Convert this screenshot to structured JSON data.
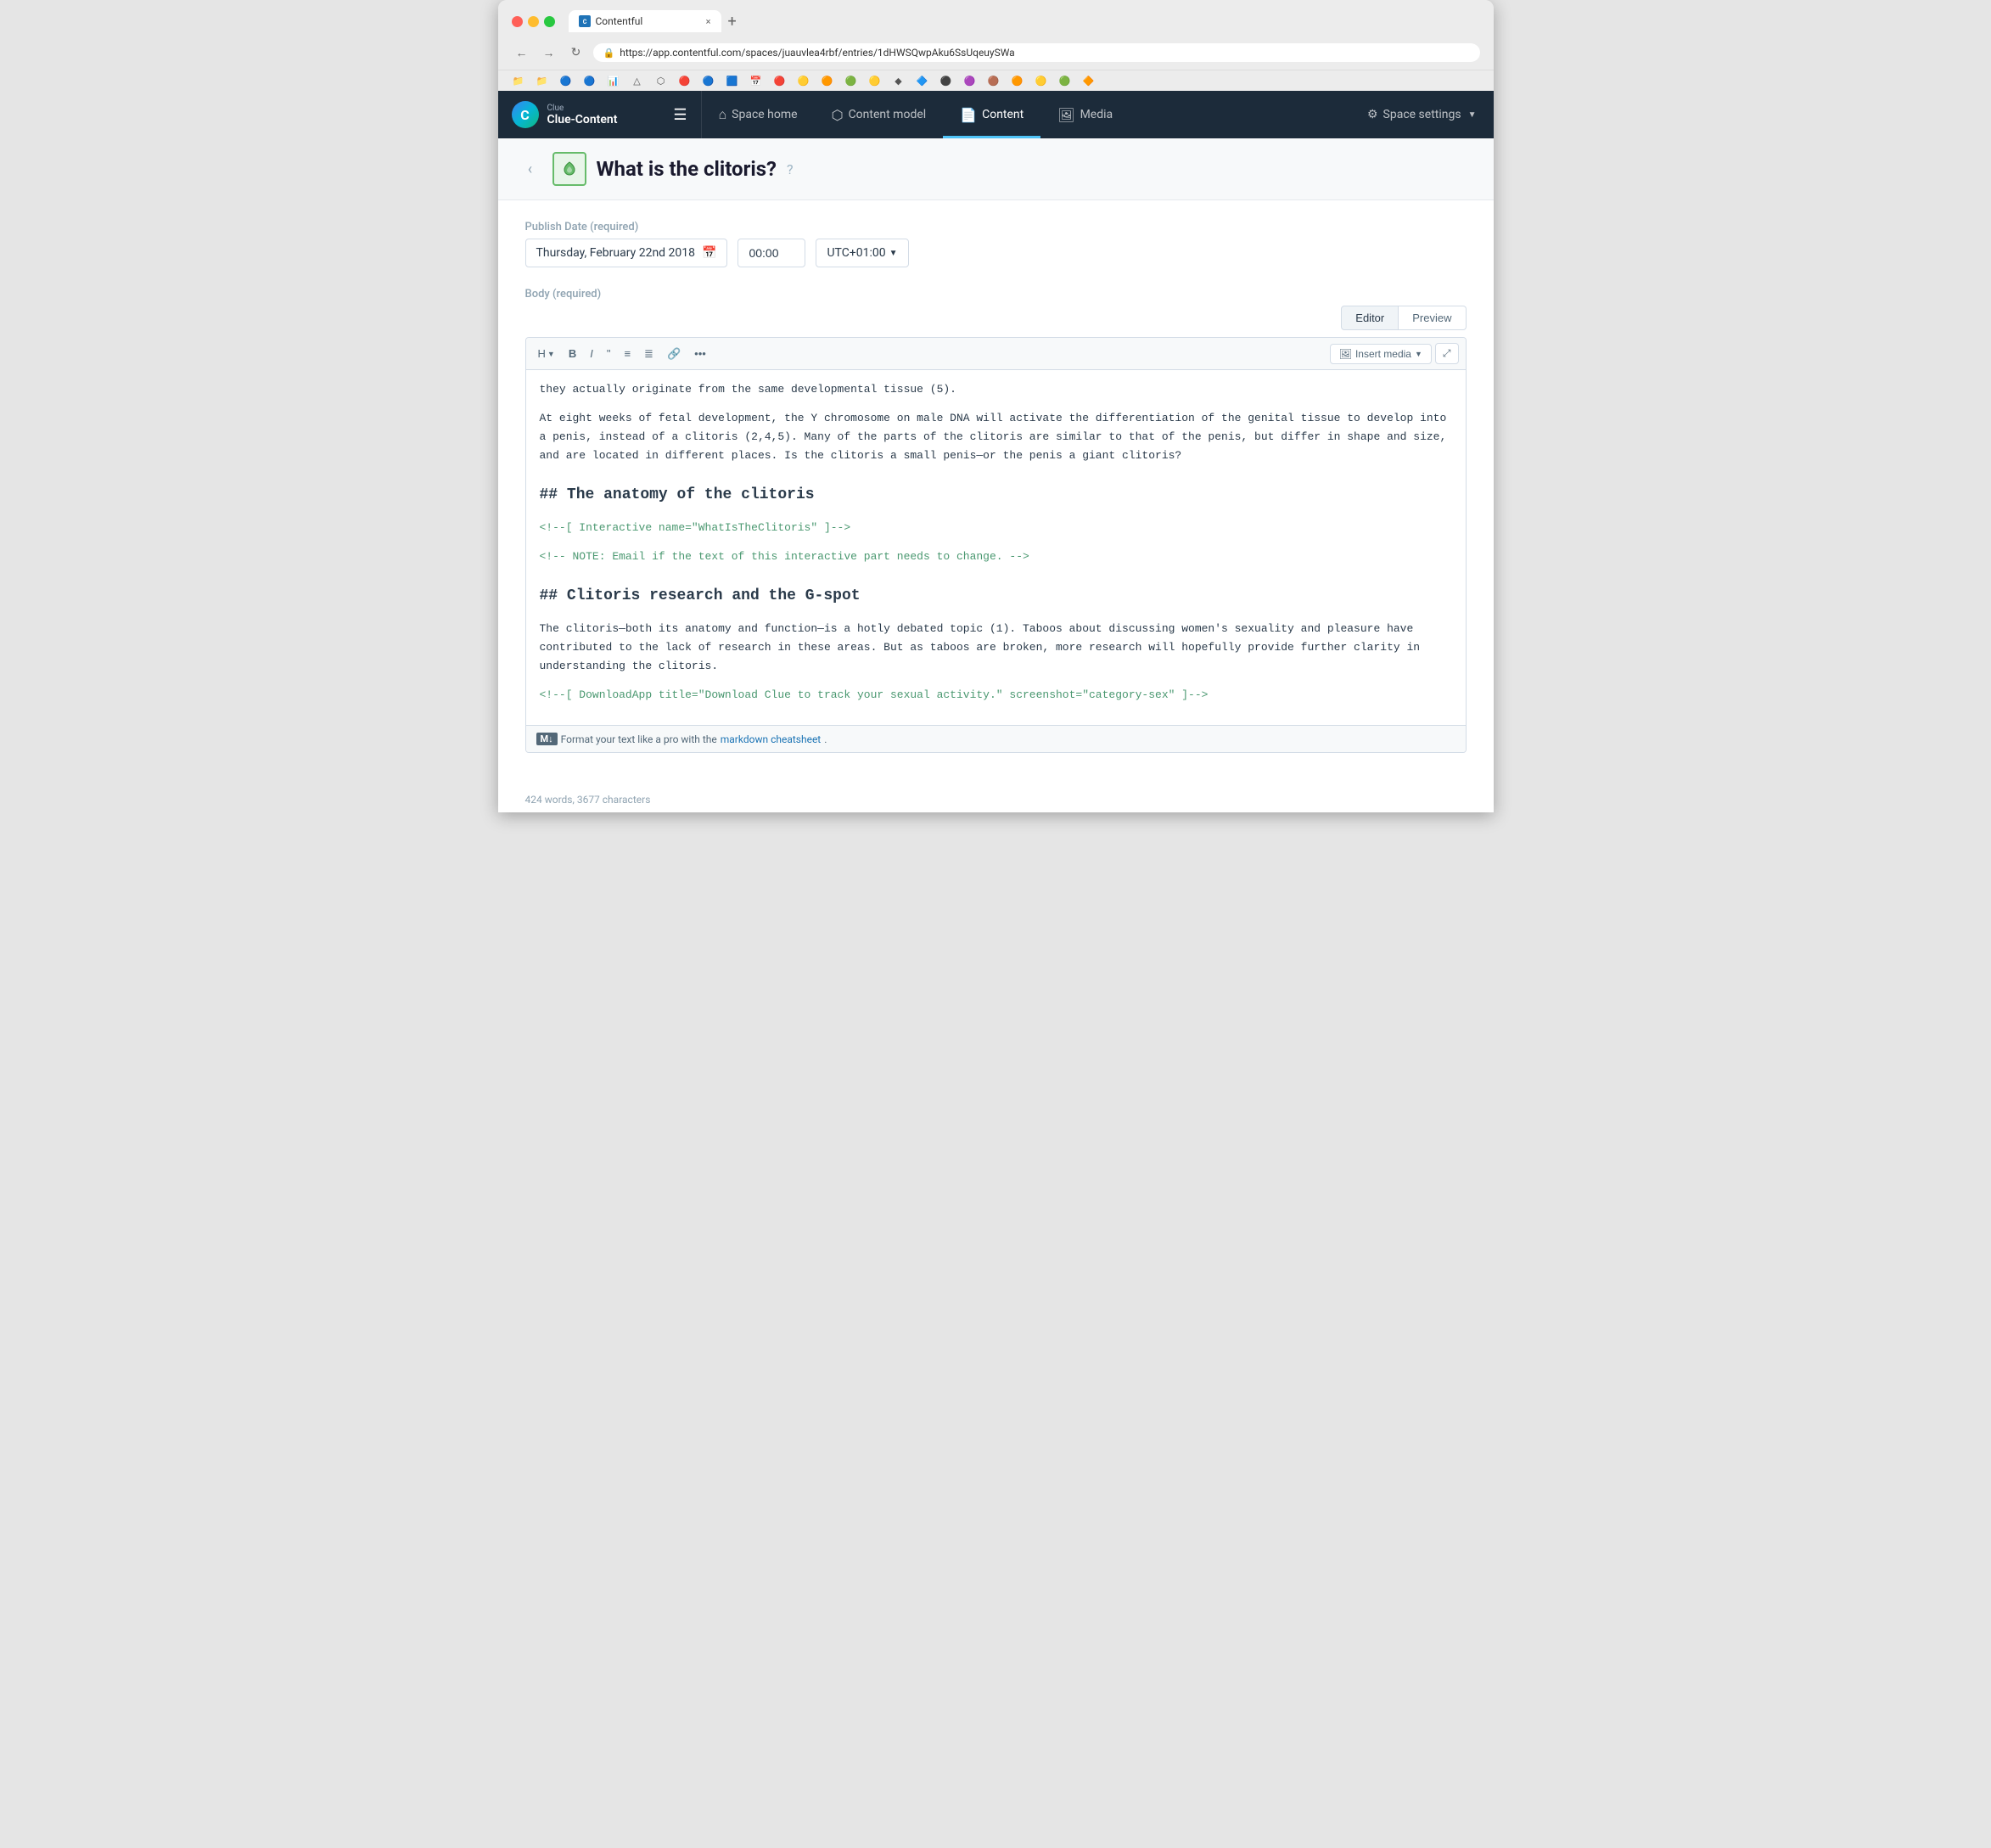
{
  "browser": {
    "tab_title": "Contentful",
    "tab_favicon": "C",
    "url": "https://app.contentful.com/spaces/juauvlea4rbf/entries/1dHWSQwpAku6SsUqeuySWa",
    "tab_close": "×",
    "tab_new": "+"
  },
  "nav": {
    "logo_letter": "C",
    "logo_subtitle": "Clue",
    "logo_title": "Clue-Content",
    "space_home": "Space home",
    "content_model": "Content model",
    "content": "Content",
    "media": "Media",
    "space_settings": "Space settings"
  },
  "entry": {
    "title": "What is the clitoris?",
    "back_label": "‹"
  },
  "publish_date": {
    "label": "Publish Date (required)",
    "value": "Thursday, February 22nd 2018",
    "time": "00:00",
    "timezone": "UTC+01:00"
  },
  "body_field": {
    "label": "Body (required)",
    "editor_tab": "Editor",
    "preview_tab": "Preview"
  },
  "toolbar": {
    "heading": "H",
    "bold": "B",
    "italic": "I",
    "quote": "❝",
    "unordered_list": "≡",
    "ordered_list": "≣",
    "link": "🔗",
    "more": "•••",
    "insert_media": "Insert media",
    "fullscreen": "⤢"
  },
  "editor_content": {
    "paragraph1": "they actually originate from the same developmental tissue (5).",
    "paragraph2": "At eight weeks of fetal development, the Y chromosome on male DNA will activate the differentiation of the genital tissue to develop into a penis, instead of a clitoris (2,4,5). Many of the parts of the clitoris are similar to that of the penis, but differ in shape and size, and are located in different places. Is the clitoris a small penis—or the penis a giant clitoris?",
    "heading1": "## The anatomy of the clitoris",
    "comment1": "<!--[ Interactive name=\"WhatIsTheClitoris\" ]-->",
    "comment2": "<!-- NOTE: Email                    if the text of this interactive part needs to change. -->",
    "heading2": "## Clitoris research and the G-spot",
    "paragraph3": "The clitoris—both its anatomy and function—is a hotly debated topic (1). Taboos about discussing women's sexuality and pleasure have contributed to the lack of research in these areas. But as taboos are broken, more research will hopefully provide further clarity in understanding the clitoris.",
    "comment3": "<!--[ DownloadApp title=\"Download Clue to track your sexual activity.\" screenshot=\"category-sex\" ]-->"
  },
  "footer": {
    "markdown_badge": "M↓",
    "format_text": "Format your text like a pro with the",
    "markdown_link": "markdown cheatsheet",
    "markdown_link_suffix": "."
  },
  "word_count": {
    "text": "424 words, 3677 characters"
  }
}
